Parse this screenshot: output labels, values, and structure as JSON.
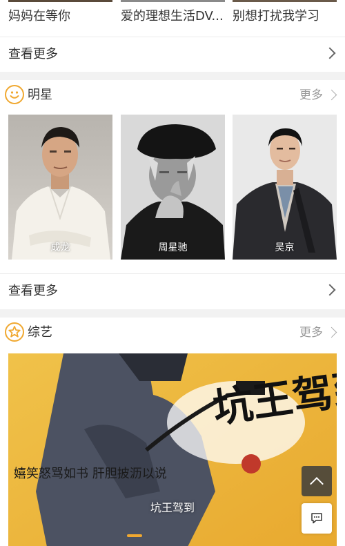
{
  "top": {
    "titles": [
      "妈妈在等你",
      "爱的理想生活DV...",
      "别想打扰我学习"
    ],
    "more_label": "查看更多"
  },
  "stars": {
    "title": "明星",
    "more": "更多",
    "icon": "smile-icon",
    "accent": "#f0a830",
    "items": [
      {
        "name": "成龙"
      },
      {
        "name": "周星驰"
      },
      {
        "name": "吴京"
      }
    ],
    "more_label": "查看更多"
  },
  "variety": {
    "title": "综艺",
    "more": "更多",
    "icon": "star-icon",
    "banner_caption": "坑王驾到",
    "banner_side_text": "坑王驾到",
    "banner_slogan": "嬉笑怒骂如书 肝胆披沥以说"
  },
  "floating": {
    "to_top_icon": "chevron-up-icon",
    "feedback_icon": "chat-icon"
  }
}
